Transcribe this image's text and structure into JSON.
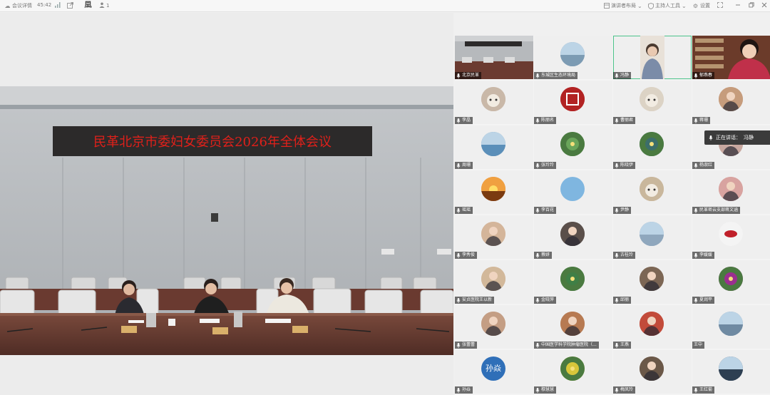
{
  "topbar": {
    "meeting_details": "会议详情",
    "duration": "45:42",
    "participant_count": "1",
    "presenter_layout": "演讲者布局",
    "host_tools": "主持人工具",
    "settings": "设置"
  },
  "video": {
    "banner": "民革北京市委妇女委员会2026年全体会议"
  },
  "speaking": {
    "label": "正在讲话：",
    "name": "冯静"
  },
  "participants": [
    {
      "name": "北京民革",
      "avatar": "conference-room",
      "color": "#8a6d5a"
    },
    {
      "name": "东城区生态环境局",
      "avatar": "landscape",
      "color": "#7c9bb3"
    },
    {
      "name": "冯静",
      "avatar": "portrait",
      "color": "#d9c2a8",
      "active": true
    },
    {
      "name": "郁燕春",
      "avatar": "portrait",
      "color": "#b8455c"
    },
    {
      "name": "李晶",
      "avatar": "pet",
      "color": "#c9b8a8"
    },
    {
      "name": "陈丽名",
      "avatar": "logo",
      "color": "#b22222"
    },
    {
      "name": "曹丽君",
      "avatar": "cat",
      "color": "#dcd3c5"
    },
    {
      "name": "蒋珊",
      "avatar": "portrait",
      "color": "#c69c7c"
    },
    {
      "name": "周珊",
      "avatar": "landscape",
      "color": "#5b8fb9"
    },
    {
      "name": "张玲玲",
      "avatar": "flower",
      "color": "#6aa55a"
    },
    {
      "name": "陈晓伊",
      "avatar": "flower",
      "color": "#3c6e6a"
    },
    {
      "name": "杨淑红",
      "avatar": "portrait",
      "color": "#c8a8a0"
    },
    {
      "name": "瑶瑶",
      "avatar": "sunset",
      "color": "#d9772b"
    },
    {
      "name": "李百花",
      "avatar": "solid",
      "color": "#7fb6e0"
    },
    {
      "name": "尹静",
      "avatar": "dog",
      "color": "#c9b79c"
    },
    {
      "name": "民革密云支部蒋文涵",
      "avatar": "portrait",
      "color": "#d8a3a0"
    },
    {
      "name": "李秀俊",
      "avatar": "portrait",
      "color": "#d4b59a"
    },
    {
      "name": "蔡妍",
      "avatar": "portrait",
      "color": "#5a4f4a"
    },
    {
      "name": "古桂玲",
      "avatar": "seascape",
      "color": "#8fa7bd"
    },
    {
      "name": "李媛媛",
      "avatar": "lips",
      "color": "#e5e5e5"
    },
    {
      "name": "安贞医院王以新",
      "avatar": "portrait",
      "color": "#d2b89a"
    },
    {
      "name": "金晓萍",
      "avatar": "lotus",
      "color": "#3f7f46"
    },
    {
      "name": "邱丽",
      "avatar": "portrait",
      "color": "#7c6654"
    },
    {
      "name": "夏润平",
      "avatar": "flower",
      "color": "#9b2f8f"
    },
    {
      "name": "张蕾蕾",
      "avatar": "portrait",
      "color": "#c49e84"
    },
    {
      "name": "中国医学科学院肿瘤医院（...",
      "avatar": "portrait",
      "color": "#b77a52"
    },
    {
      "name": "王燕",
      "avatar": "portrait",
      "color": "#c24b3a"
    },
    {
      "name": "王中",
      "avatar": "seascape",
      "color": "#6f8aa2",
      "no_mic": true
    },
    {
      "name": "孙焱",
      "avatar": "text",
      "text": "孙焱",
      "color": "#2f6fb8"
    },
    {
      "name": "穆慧慧",
      "avatar": "flower",
      "color": "#d8c63a"
    },
    {
      "name": "梅凤玲",
      "avatar": "portrait",
      "color": "#6b5848"
    },
    {
      "name": "王红菊",
      "avatar": "seascape",
      "color": "#2d3f52"
    }
  ]
}
